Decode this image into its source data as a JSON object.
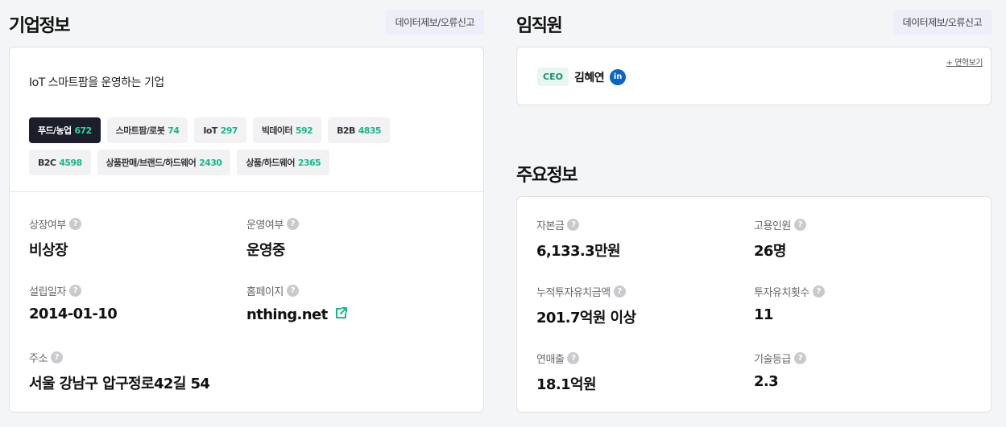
{
  "company": {
    "title": "기업정보",
    "report_label": "데이터제보/오류신고",
    "description": "IoT 스마트팜을 운영하는 기업",
    "tags": [
      {
        "label": "푸드/농업",
        "count": "672"
      },
      {
        "label": "스마트팜/로봇",
        "count": "74"
      },
      {
        "label": "IoT",
        "count": "297"
      },
      {
        "label": "빅데이터",
        "count": "592"
      },
      {
        "label": "B2B",
        "count": "4835"
      },
      {
        "label": "B2C",
        "count": "4598"
      },
      {
        "label": "상품판매/브랜드/하드웨어",
        "count": "2430"
      },
      {
        "label": "상품/하드웨어",
        "count": "2365"
      }
    ],
    "info": {
      "listing_label": "상장여부",
      "listing_value": "비상장",
      "status_label": "운영여부",
      "status_value": "운영중",
      "founded_label": "설립일자",
      "founded_value": "2014-01-10",
      "homepage_label": "홈페이지",
      "homepage_value": "nthing.net",
      "address_label": "주소",
      "address_value": "서울 강남구 압구정로42길 54"
    }
  },
  "staff": {
    "title": "임직원",
    "report_label": "데이터제보/오류신고",
    "more_label": "+ 연혁보기",
    "role": "CEO",
    "name": "김혜연",
    "linkedin_glyph": "in"
  },
  "main_info": {
    "title": "주요정보",
    "items": {
      "capital_label": "자본금",
      "capital_value": "6,133.3만원",
      "employees_label": "고용인원",
      "employees_value": "26명",
      "investment_label": "누적투자유치금액",
      "investment_value": "201.7억원 이상",
      "rounds_label": "투자유치횟수",
      "rounds_value": "11",
      "revenue_label": "연매출",
      "revenue_value": "18.1억원",
      "grade_label": "기술등급",
      "grade_value": "2.3"
    }
  },
  "icons": {
    "help_glyph": "?",
    "external_link": "external-link-icon"
  },
  "colors": {
    "accent_green": "#16b88a",
    "active_tag_bg": "#1c1e2c",
    "linkedin_blue": "#0a66c2"
  }
}
